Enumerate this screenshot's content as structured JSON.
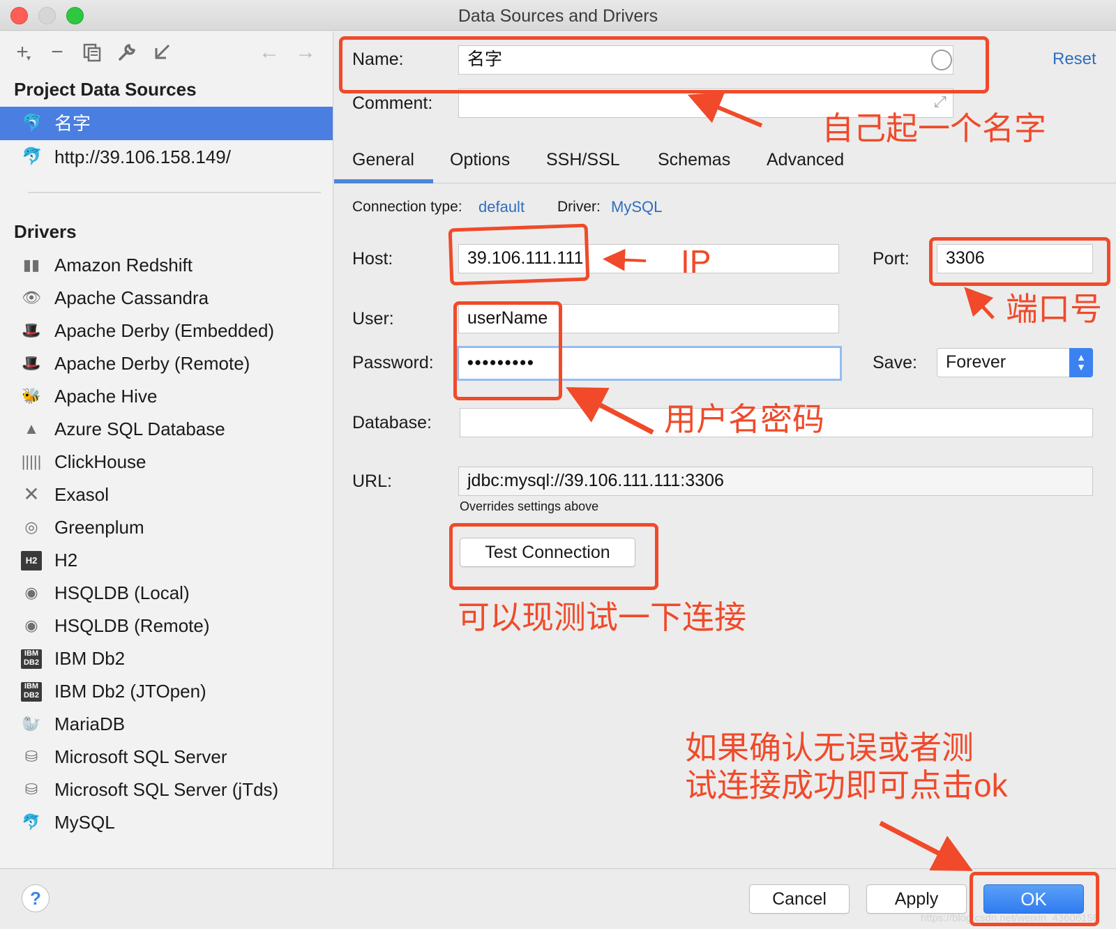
{
  "window": {
    "title": "Data Sources and Drivers"
  },
  "toolbar": {
    "add_icon": "plus-icon",
    "remove_icon": "minus-icon",
    "copy_icon": "copy-icon",
    "settings_icon": "wrench-icon",
    "import_icon": "import-icon",
    "back_icon": "arrow-left-icon",
    "forward_icon": "arrow-right-icon"
  },
  "sidebar": {
    "project_title": "Project Data Sources",
    "project_items": [
      {
        "label": "名字",
        "icon": "mysql-dolphin-icon",
        "selected": true
      },
      {
        "label": "http://39.106.158.149/",
        "icon": "mysql-dolphin-icon",
        "selected": false
      }
    ],
    "drivers_title": "Drivers",
    "drivers": [
      {
        "label": "Amazon Redshift",
        "icon": "redshift-icon"
      },
      {
        "label": "Apache Cassandra",
        "icon": "cassandra-eye-icon"
      },
      {
        "label": "Apache Derby (Embedded)",
        "icon": "derby-hat-icon"
      },
      {
        "label": "Apache Derby (Remote)",
        "icon": "derby-hat-icon"
      },
      {
        "label": "Apache Hive",
        "icon": "hive-icon"
      },
      {
        "label": "Azure SQL Database",
        "icon": "azure-icon"
      },
      {
        "label": "ClickHouse",
        "icon": "clickhouse-bars-icon"
      },
      {
        "label": "Exasol",
        "icon": "exasol-x-icon"
      },
      {
        "label": "Greenplum",
        "icon": "greenplum-circle-icon"
      },
      {
        "label": "H2",
        "icon": "h2-icon"
      },
      {
        "label": "HSQLDB (Local)",
        "icon": "hsqldb-icon"
      },
      {
        "label": "HSQLDB (Remote)",
        "icon": "hsqldb-icon"
      },
      {
        "label": "IBM Db2",
        "icon": "ibm-db2-icon"
      },
      {
        "label": "IBM Db2 (JTOpen)",
        "icon": "ibm-db2-icon"
      },
      {
        "label": "MariaDB",
        "icon": "mariadb-seal-icon"
      },
      {
        "label": "Microsoft SQL Server",
        "icon": "sqlserver-icon"
      },
      {
        "label": "Microsoft SQL Server (jTds)",
        "icon": "sqlserver-icon"
      },
      {
        "label": "MySQL",
        "icon": "mysql-dolphin-icon"
      }
    ]
  },
  "form": {
    "name_label": "Name:",
    "name_value": "名字",
    "comment_label": "Comment:",
    "comment_value": "",
    "reset_label": "Reset",
    "tabs": [
      "General",
      "Options",
      "SSH/SSL",
      "Schemas",
      "Advanced"
    ],
    "active_tab": "General",
    "connection_type_label": "Connection type:",
    "connection_type_value": "default",
    "driver_label": "Driver:",
    "driver_value": "MySQL",
    "host_label": "Host:",
    "host_value": "39.106.111.111",
    "port_label": "Port:",
    "port_value": "3306",
    "user_label": "User:",
    "user_value": "userName",
    "password_label": "Password:",
    "password_value": "•••••••••",
    "save_label": "Save:",
    "save_value": "Forever",
    "database_label": "Database:",
    "database_value": "",
    "url_label": "URL:",
    "url_value": "jdbc:mysql://39.106.111.111:3306",
    "url_note": "Overrides settings above",
    "test_connection_label": "Test Connection"
  },
  "footer": {
    "help_label": "?",
    "cancel_label": "Cancel",
    "apply_label": "Apply",
    "ok_label": "OK",
    "watermark": "https://blog.csdn.net/weixin_43606158"
  },
  "annotations": {
    "name_note": "自己起一个名字",
    "ip_note": "IP",
    "port_note": "端口号",
    "credentials_note": "用户名密码",
    "test_note": "可以现测试一下连接",
    "ok_note_line1": "如果确认无误或者测",
    "ok_note_line2": "试连接成功即可点击ok",
    "color": "#f04a2a"
  }
}
